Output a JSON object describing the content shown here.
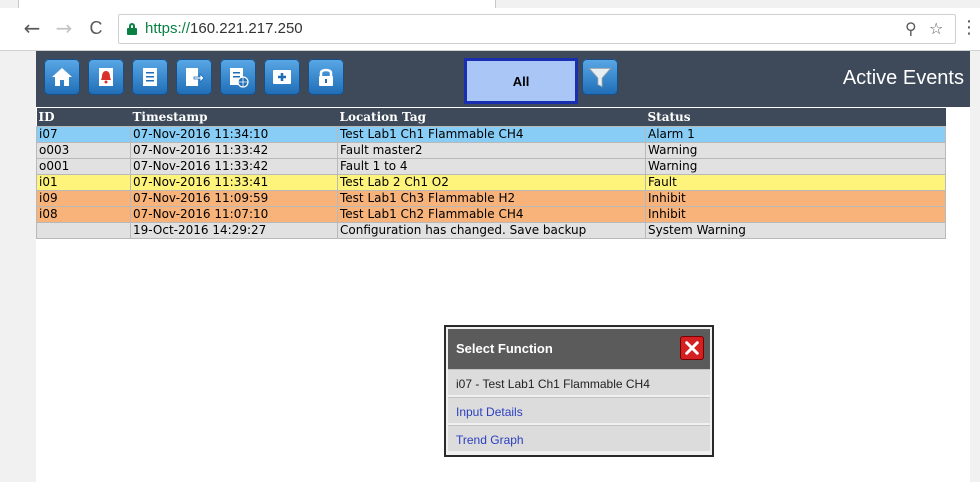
{
  "browser": {
    "url_scheme": "https://",
    "url_host": "160.221.217.250",
    "back_icon": "←",
    "forward_icon": "→",
    "reload_icon": "C",
    "zoom_icon": "⚲",
    "star_icon": "☆",
    "menu_icon": "⋮"
  },
  "app": {
    "title": "Active Events",
    "filter_label": "All",
    "toolbar_icons": [
      "home-icon",
      "alarm-report-icon",
      "document-icon",
      "export-icon",
      "report-globe-icon",
      "add-card-icon",
      "lock-icon",
      "filter-icon"
    ]
  },
  "table": {
    "columns": [
      "ID",
      "Timestamp",
      "Location Tag",
      "Status"
    ],
    "rows": [
      {
        "id": "i07",
        "timestamp": "07-Nov-2016 11:34:10",
        "location": "Test Lab1 Ch1 Flammable CH4",
        "status": "Alarm 1",
        "color": "#87cdf5"
      },
      {
        "id": "o003",
        "timestamp": "07-Nov-2016 11:33:42",
        "location": "Fault master2",
        "status": "Warning",
        "color": "#e1e1e1"
      },
      {
        "id": "o001",
        "timestamp": "07-Nov-2016 11:33:42",
        "location": "Fault 1 to 4",
        "status": "Warning",
        "color": "#e1e1e1"
      },
      {
        "id": "i01",
        "timestamp": "07-Nov-2016 11:33:41",
        "location": "Test Lab 2 Ch1 O2",
        "status": "Fault",
        "color": "#fff47b"
      },
      {
        "id": "i09",
        "timestamp": "07-Nov-2016 11:09:59",
        "location": "Test Lab1 Ch3 Flammable H2",
        "status": "Inhibit",
        "color": "#f8b37a"
      },
      {
        "id": "i08",
        "timestamp": "07-Nov-2016 11:07:10",
        "location": "Test Lab1 Ch2 Flammable CH4",
        "status": "Inhibit",
        "color": "#f8b37a"
      },
      {
        "id": "",
        "timestamp": "19-Oct-2016 14:29:27",
        "location": "Configuration has changed. Save backup",
        "status": "System Warning",
        "color": "#e1e1e1"
      }
    ]
  },
  "popup": {
    "title": "Select Function",
    "selected": "i07 - Test Lab1 Ch1 Flammable CH4",
    "options": [
      "Input Details",
      "Trend Graph"
    ]
  }
}
